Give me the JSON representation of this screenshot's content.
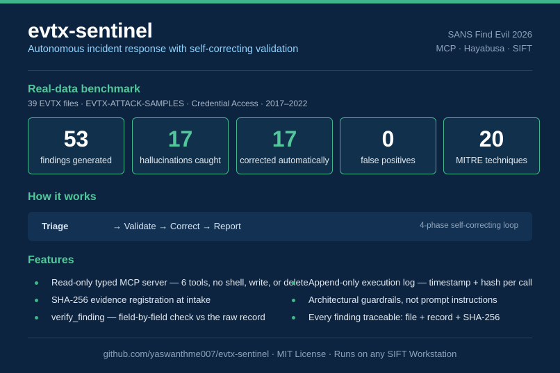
{
  "header": {
    "title": "evtx-sentinel",
    "subtitle": "Autonomous incident response with self-correcting validation",
    "meta_line1": "SANS Find Evil 2026",
    "meta_line2": "MCP · Hayabusa · SIFT"
  },
  "benchmark": {
    "title": "Real-data benchmark",
    "caption": "39 EVTX files · EVTX-ATTACK-SAMPLES · Credential Access · 2017–2022",
    "stats": [
      {
        "value": "53",
        "label": "findings generated",
        "color": "#ffffff"
      },
      {
        "value": "17",
        "label": "hallucinations caught",
        "color": "#52c79b"
      },
      {
        "value": "17",
        "label": "corrected automatically",
        "color": "#52c79b"
      },
      {
        "value": "0",
        "label": "false positives",
        "color": "#ffffff"
      },
      {
        "value": "20",
        "label": "MITRE techniques",
        "color": "#ffffff"
      }
    ]
  },
  "how": {
    "title": "How it works",
    "first_step": "Triage",
    "rest_steps": "→ Validate → Correct → Report",
    "note": "4-phase self-correcting loop"
  },
  "features": {
    "title": "Features",
    "items": [
      "Read-only typed MCP server — 6 tools, no shell, write, or delete",
      "SHA-256 evidence registration at intake",
      "verify_finding — field-by-field check vs the raw record",
      "Append-only execution log — timestamp + hash per call",
      "Architectural guardrails, not prompt instructions",
      "Every finding traceable: file + record + SHA-256"
    ]
  },
  "footer": {
    "text": "github.com/yaswanthme007/evtx-sentinel · MIT License · Runs on any SIFT Workstation"
  },
  "colors": {
    "background": "#0d2440",
    "accent": "#3fb68b",
    "accent_text": "#52c79b",
    "subtitle": "#8fd3ff"
  }
}
